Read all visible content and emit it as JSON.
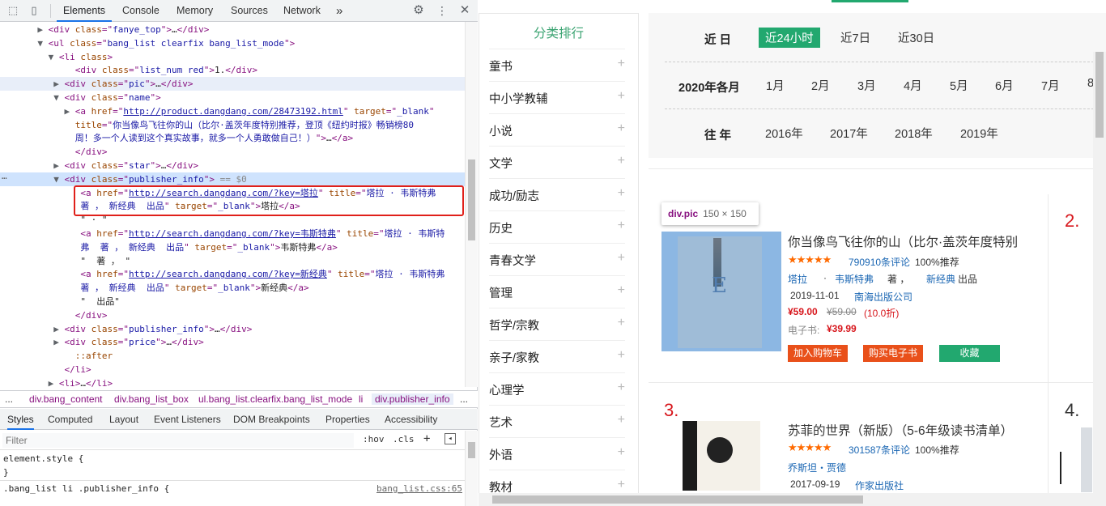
{
  "devtools": {
    "tabs": [
      "Elements",
      "Console",
      "Memory",
      "Sources",
      "Network"
    ],
    "more_label": "»",
    "dom_lines": [
      {
        "indent": 9,
        "tri": "▶",
        "parts": [
          [
            "tag",
            "<div "
          ],
          [
            "an",
            "class"
          ],
          [
            "tag",
            "=\""
          ],
          [
            "av",
            "fanye_top"
          ],
          [
            "tag",
            "\">"
          ],
          [
            "tx",
            "…"
          ],
          [
            "tag",
            "</div>"
          ]
        ]
      },
      {
        "indent": 9,
        "tri": "▼",
        "parts": [
          [
            "tag",
            "<ul "
          ],
          [
            "an",
            "class"
          ],
          [
            "tag",
            "=\""
          ],
          [
            "av",
            "bang_list clearfix bang_list_mode"
          ],
          [
            "tag",
            "\">"
          ]
        ]
      },
      {
        "indent": 11,
        "tri": "▼",
        "parts": [
          [
            "tag",
            "<li "
          ],
          [
            "an",
            "class"
          ],
          [
            "tag",
            ">"
          ]
        ]
      },
      {
        "indent": 14,
        "tri": "",
        "parts": [
          [
            "tag",
            "<div "
          ],
          [
            "an",
            "class"
          ],
          [
            "tag",
            "=\""
          ],
          [
            "av",
            "list_num red"
          ],
          [
            "tag",
            "\">"
          ],
          [
            "tx",
            "1."
          ],
          [
            "tag",
            "</div>"
          ]
        ]
      },
      {
        "indent": 12,
        "tri": "▶",
        "parts": [
          [
            "tag",
            "<div "
          ],
          [
            "an",
            "class"
          ],
          [
            "tag",
            "=\""
          ],
          [
            "av",
            "pic"
          ],
          [
            "tag",
            "\">"
          ],
          [
            "tx",
            "…"
          ],
          [
            "tag",
            "</div>"
          ]
        ]
      },
      {
        "indent": 12,
        "tri": "▼",
        "parts": [
          [
            "tag",
            "<div "
          ],
          [
            "an",
            "class"
          ],
          [
            "tag",
            "=\""
          ],
          [
            "av",
            "name"
          ],
          [
            "tag",
            "\">"
          ]
        ]
      },
      {
        "indent": 14,
        "tri": "▶",
        "parts": [
          [
            "tag",
            "<a "
          ],
          [
            "an",
            "href"
          ],
          [
            "tag",
            "=\""
          ],
          [
            "al",
            "http://product.dangdang.com/28473192.html"
          ],
          [
            "tag",
            "\" "
          ],
          [
            "an",
            "target"
          ],
          [
            "tag",
            "=\""
          ],
          [
            "av",
            "_blank"
          ],
          [
            "tag",
            "\""
          ]
        ]
      },
      {
        "indent": 14,
        "tri": "",
        "parts": [
          [
            "an",
            "title"
          ],
          [
            "tag",
            "=\""
          ],
          [
            "av",
            "你当像鸟飞往你的山（比尔·盖茨年度特别推荐，登顶《纽约时报》畅销榜80"
          ]
        ]
      },
      {
        "indent": 14,
        "tri": "",
        "parts": [
          [
            "av",
            "周！多一个人读到这个真实故事，就多一个人勇敢做自己！）"
          ],
          [
            "tag",
            "\">"
          ],
          [
            "tx",
            "…"
          ],
          [
            "tag",
            "</a>"
          ]
        ]
      },
      {
        "indent": 14,
        "tri": "",
        "parts": [
          [
            "tag",
            "</div>"
          ]
        ]
      },
      {
        "indent": 12,
        "tri": "▶",
        "parts": [
          [
            "tag",
            "<div "
          ],
          [
            "an",
            "class"
          ],
          [
            "tag",
            "=\""
          ],
          [
            "av",
            "star"
          ],
          [
            "tag",
            "\">"
          ],
          [
            "tx",
            "…"
          ],
          [
            "tag",
            "</div>"
          ]
        ]
      },
      {
        "indent": 12,
        "tri": "▼",
        "parts": [
          [
            "tag",
            "<div "
          ],
          [
            "an",
            "class"
          ],
          [
            "tag",
            "=\""
          ],
          [
            "av",
            "publisher_info"
          ],
          [
            "tag",
            "\">"
          ],
          [
            "eq",
            " == $0"
          ]
        ]
      },
      {
        "indent": 15,
        "tri": "",
        "parts": [
          [
            "tag",
            "<a "
          ],
          [
            "an",
            "href"
          ],
          [
            "tag",
            "=\""
          ],
          [
            "al",
            "http://search.dangdang.com/?key=塔拉"
          ],
          [
            "tag",
            "\" "
          ],
          [
            "an",
            "title"
          ],
          [
            "tag",
            "=\""
          ],
          [
            "av",
            "塔拉 · 韦斯特弗"
          ]
        ]
      },
      {
        "indent": 15,
        "tri": "",
        "parts": [
          [
            "av",
            "著 ， 新经典  出品"
          ],
          [
            "tag",
            "\" "
          ],
          [
            "an",
            "target"
          ],
          [
            "tag",
            "=\""
          ],
          [
            "av",
            "_blank"
          ],
          [
            "tag",
            "\">"
          ],
          [
            "tx",
            "塔拉"
          ],
          [
            "tag",
            "</a>"
          ]
        ]
      },
      {
        "indent": 15,
        "tri": "",
        "parts": [
          [
            "tx",
            "\" · \""
          ]
        ]
      },
      {
        "indent": 15,
        "tri": "",
        "parts": [
          [
            "tag",
            "<a "
          ],
          [
            "an",
            "href"
          ],
          [
            "tag",
            "=\""
          ],
          [
            "al",
            "http://search.dangdang.com/?key=韦斯特弗"
          ],
          [
            "tag",
            "\" "
          ],
          [
            "an",
            "title"
          ],
          [
            "tag",
            "=\""
          ],
          [
            "av",
            "塔拉 · 韦斯特"
          ]
        ]
      },
      {
        "indent": 15,
        "tri": "",
        "parts": [
          [
            "av",
            "弗  著 ， 新经典  出品"
          ],
          [
            "tag",
            "\" "
          ],
          [
            "an",
            "target"
          ],
          [
            "tag",
            "=\""
          ],
          [
            "av",
            "_blank"
          ],
          [
            "tag",
            "\">"
          ],
          [
            "tx",
            "韦斯特弗"
          ],
          [
            "tag",
            "</a>"
          ]
        ]
      },
      {
        "indent": 15,
        "tri": "",
        "parts": [
          [
            "tx",
            "\"  著 ， \""
          ]
        ]
      },
      {
        "indent": 15,
        "tri": "",
        "parts": [
          [
            "tag",
            "<a "
          ],
          [
            "an",
            "href"
          ],
          [
            "tag",
            "=\""
          ],
          [
            "al",
            "http://search.dangdang.com/?key=新经典"
          ],
          [
            "tag",
            "\" "
          ],
          [
            "an",
            "title"
          ],
          [
            "tag",
            "=\""
          ],
          [
            "av",
            "塔拉 · 韦斯特弗"
          ]
        ]
      },
      {
        "indent": 15,
        "tri": "",
        "parts": [
          [
            "av",
            "著 ， 新经典  出品"
          ],
          [
            "tag",
            "\" "
          ],
          [
            "an",
            "target"
          ],
          [
            "tag",
            "=\""
          ],
          [
            "av",
            "_blank"
          ],
          [
            "tag",
            "\">"
          ],
          [
            "tx",
            "新经典"
          ],
          [
            "tag",
            "</a>"
          ]
        ]
      },
      {
        "indent": 15,
        "tri": "",
        "parts": [
          [
            "tx",
            "\"  出品\""
          ]
        ]
      },
      {
        "indent": 14,
        "tri": "",
        "parts": [
          [
            "tag",
            "</div>"
          ]
        ]
      },
      {
        "indent": 12,
        "tri": "▶",
        "parts": [
          [
            "tag",
            "<div "
          ],
          [
            "an",
            "class"
          ],
          [
            "tag",
            "=\""
          ],
          [
            "av",
            "publisher_info"
          ],
          [
            "tag",
            "\">"
          ],
          [
            "tx",
            "…"
          ],
          [
            "tag",
            "</div>"
          ]
        ]
      },
      {
        "indent": 12,
        "tri": "▶",
        "parts": [
          [
            "tag",
            "<div "
          ],
          [
            "an",
            "class"
          ],
          [
            "tag",
            "=\""
          ],
          [
            "av",
            "price"
          ],
          [
            "tag",
            "\">"
          ],
          [
            "tx",
            "…"
          ],
          [
            "tag",
            "</div>"
          ]
        ]
      },
      {
        "indent": 14,
        "tri": "",
        "parts": [
          [
            "an",
            "::after"
          ]
        ]
      },
      {
        "indent": 12,
        "tri": "",
        "parts": [
          [
            "tag",
            "</li>"
          ]
        ]
      },
      {
        "indent": 11,
        "tri": "▶",
        "parts": [
          [
            "tag",
            "<li>"
          ],
          [
            "tx",
            "…"
          ],
          [
            "tag",
            "</li>"
          ]
        ]
      }
    ],
    "breadcrumbs": [
      "...",
      "div.bang_content",
      "div.bang_list_box",
      "ul.bang_list.clearfix.bang_list_mode",
      "li",
      "div.publisher_info",
      "..."
    ],
    "sub_tabs": [
      "Styles",
      "Computed",
      "Layout",
      "Event Listeners",
      "DOM Breakpoints",
      "Properties",
      "Accessibility"
    ],
    "filter_placeholder": "Filter",
    "hov_label": ":hov",
    "cls_label": ".cls",
    "plus_label": "+",
    "styles_lines": [
      "element.style {",
      "}",
      ".bang_list li .publisher_info {"
    ],
    "styles_source": "bang_list.css:65"
  },
  "webpage": {
    "sidebar_title": "分类排行",
    "categories": [
      "童书",
      "中小学教辅",
      "小说",
      "文学",
      "成功/励志",
      "历史",
      "青春文学",
      "管理",
      "哲学/宗教",
      "亲子/家教",
      "心理学",
      "艺术",
      "外语",
      "教材"
    ],
    "filter": {
      "recent_label": "近  日",
      "recent_options": [
        "近24小时",
        "近7日",
        "近30日"
      ],
      "month_label": "2020年各月",
      "months": [
        "1月",
        "2月",
        "3月",
        "4月",
        "5月",
        "6月",
        "7月",
        "8"
      ],
      "year_label": "往  年",
      "years": [
        "2016年",
        "2017年",
        "2018年",
        "2019年"
      ]
    },
    "tooltip": {
      "name": "div.pic",
      "size": "150 × 150"
    },
    "book1": {
      "title": "你当像鸟飞往你的山（比尔·盖茨年度特别",
      "stars": "★★★★★",
      "reviews": "790910条评论",
      "recommend": "100%推荐",
      "author1": "塔拉",
      "dot": "·",
      "author2": "韦斯特弗",
      "zhu": "著 ，",
      "publisher_brand": "新经典",
      "chupin": "出品",
      "date": "2019-11-01",
      "press": "南海出版公司",
      "price": "¥59.00",
      "orig_price": "¥59.00",
      "discount": "(10.0折)",
      "ebook_label": "电子书:",
      "ebook_price": "¥39.99",
      "btn_cart": "加入购物车",
      "btn_ebook": "购买电子书",
      "btn_fav": "收藏",
      "cover_E": "E"
    },
    "book2": {
      "title": "苏菲的世界（新版）（5-6年级读书清单）",
      "stars": "★★★★★",
      "reviews": "301587条评论",
      "recommend": "100%推荐",
      "author": "乔斯坦・贾德",
      "date": "2017-09-19",
      "press": "作家出版社"
    },
    "ranks": {
      "r2": "2.",
      "r3": "3.",
      "r4": "4."
    },
    "colors": {
      "accent_green": "#22a86f",
      "rank_red": "#d7161c",
      "button_orange": "#e9501a",
      "link_blue": "#1a66b3"
    }
  }
}
